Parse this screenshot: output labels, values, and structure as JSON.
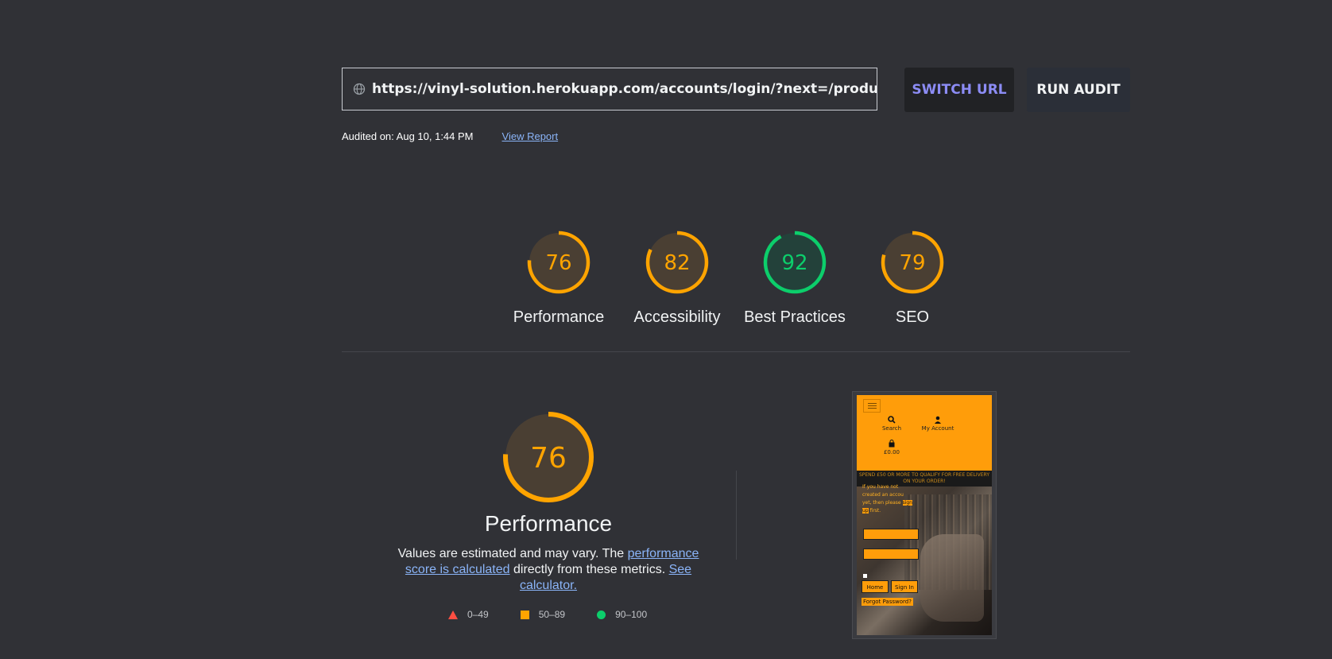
{
  "url_bar": {
    "url": "https://vinyl-solution.herokuapp.com/accounts/login/?next=/products/...",
    "globe_icon": "globe-icon"
  },
  "buttons": {
    "switch_url": "SWITCH URL",
    "run_audit": "RUN AUDIT"
  },
  "audit": {
    "audited_on": "Audited on: Aug 10, 1:44 PM",
    "view_report": "View Report"
  },
  "scores": [
    {
      "value": "76",
      "label": "Performance",
      "status": "average"
    },
    {
      "value": "82",
      "label": "Accessibility",
      "status": "average"
    },
    {
      "value": "92",
      "label": "Best Practices",
      "status": "pass"
    },
    {
      "value": "79",
      "label": "SEO",
      "status": "average"
    }
  ],
  "colors": {
    "average": "#ffa400",
    "pass": "#0cce6b",
    "fail": "#ff4e42",
    "average_fill": "#4a3f33",
    "pass_fill": "#23413a"
  },
  "performance": {
    "score": "76",
    "title": "Performance",
    "desc_prefix": "Values are estimated and may vary. The ",
    "desc_link1": "performance score is calculated",
    "desc_middle": " directly from these metrics. ",
    "desc_link2": "See calculator."
  },
  "legend": [
    {
      "shape": "triangle",
      "range": "0–49"
    },
    {
      "shape": "square",
      "range": "50–89"
    },
    {
      "shape": "circle",
      "range": "90–100"
    }
  ],
  "thumbnail": {
    "search": "Search",
    "my_account": "My Account",
    "bag_total": "£0.00",
    "banner": "SPEND £50 OR MORE TO QUALIFY FOR FREE DELIVERY ON YOUR ORDER!",
    "intro_1": "If you have not",
    "intro_2": "created an accou",
    "intro_3": "yet, then please",
    "intro_sign": "sign",
    "intro_up": "up",
    "intro_first": "first.",
    "home": "Home",
    "sign_in": "Sign In",
    "forgot": "Forgot Password?"
  }
}
